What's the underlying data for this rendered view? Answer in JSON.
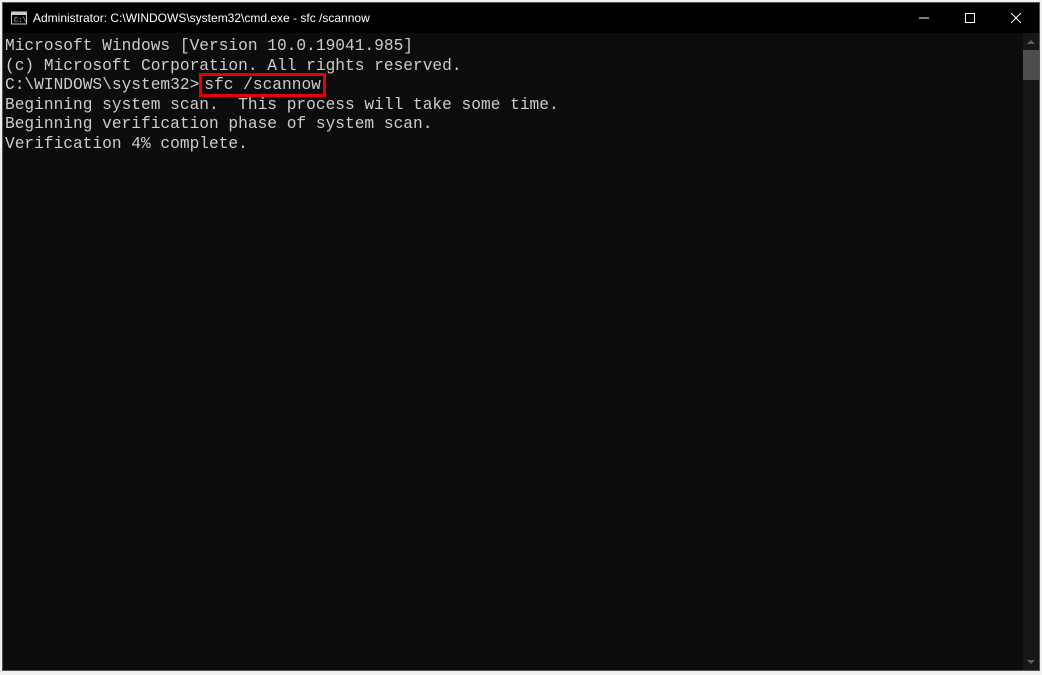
{
  "titlebar": {
    "title": "Administrator: C:\\WINDOWS\\system32\\cmd.exe - sfc  /scannow"
  },
  "terminal": {
    "line1": "Microsoft Windows [Version 10.0.19041.985]",
    "line2": "(c) Microsoft Corporation. All rights reserved.",
    "blank1": "",
    "prompt": "C:\\WINDOWS\\system32>",
    "command": "sfc /scannow",
    "blank2": "",
    "line_scan": "Beginning system scan.  This process will take some time.",
    "blank3": "",
    "line_verify": "Beginning verification phase of system scan.",
    "line_progress": "Verification 4% complete."
  }
}
